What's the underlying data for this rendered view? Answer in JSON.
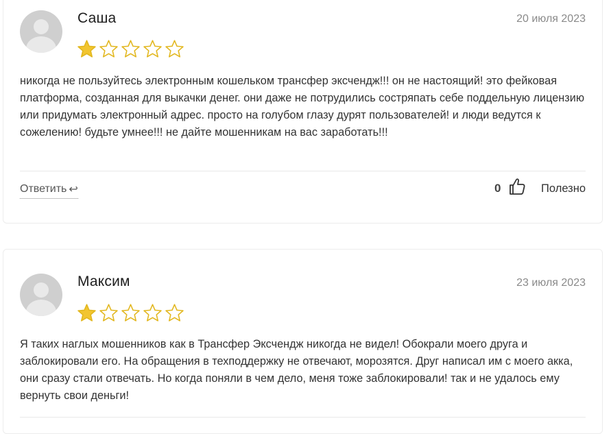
{
  "reviews": [
    {
      "name": "Саша",
      "date": "20 июля 2023",
      "rating": 1,
      "max_rating": 5,
      "text": "никогда не пользуйтесь электронным кошельком трансфер эксчендж!!! он не настоящий! это фейковая платформа, созданная для выкачки денег. они даже не потрудились состряпать себе поддельную лицензию или придумать электронный адрес. просто на голубом глазу дурят пользователей! и люди ведутся к сожелению! будьте умнее!!! не дайте мошенникам на вас заработать!!!",
      "reply_label": "Ответить",
      "votes": "0",
      "useful_label": "Полезно"
    },
    {
      "name": "Максим",
      "date": "23 июля 2023",
      "rating": 1,
      "max_rating": 5,
      "text": "Я таких наглых мошенников как в Трансфер Эксчендж никогда не видел! Обокрали моего друга и заблокировали его. На обращения в техподдержку не отвечают, морозятся. Друг написал им с моего акка, они сразу стали отвечать. Но когда поняли в чем дело, меня тоже заблокировали! так и не удалось ему вернуть свои деньги!"
    }
  ],
  "colors": {
    "star_filled": "#f2c530",
    "star_outline": "#e2b71e",
    "avatar_bg": "#cfcfcf"
  },
  "icons": {
    "reply": "reply-arrow-icon",
    "thumb": "thumbs-up-icon",
    "star": "star-icon",
    "avatar": "user-avatar-icon"
  }
}
